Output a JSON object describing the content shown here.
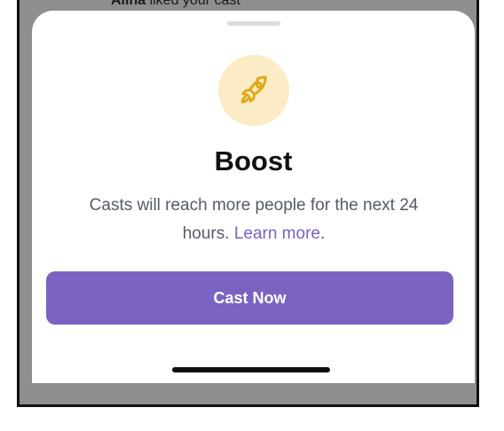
{
  "notification": {
    "name": "Alina",
    "text": " liked your cast"
  },
  "sheet": {
    "icon": "rocket-icon",
    "title": "Boost",
    "description": "Casts will reach more people for the next 24 hours.",
    "link_text": "Learn more",
    "link_suffix": ".",
    "button_label": "Cast Now"
  },
  "colors": {
    "accent": "#7b64c1",
    "link": "#7a5fc0",
    "icon_bg": "#fbecc5",
    "icon_fg": "#e0a81a"
  }
}
